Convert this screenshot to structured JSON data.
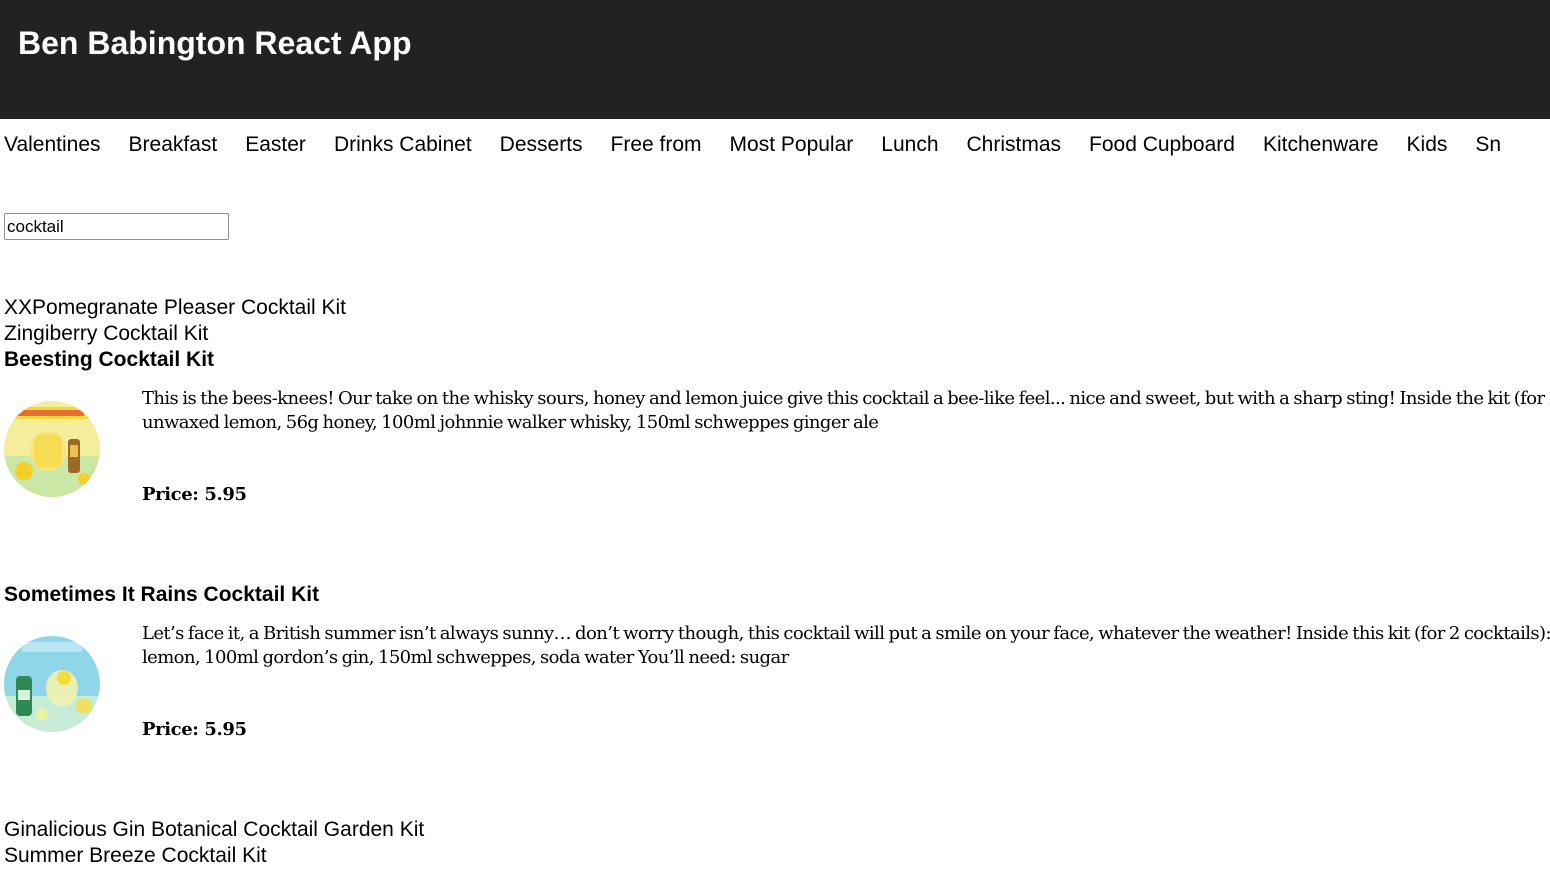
{
  "app": {
    "title": "Ben Babington React App"
  },
  "nav": {
    "items": [
      {
        "label": "Valentines"
      },
      {
        "label": "Breakfast"
      },
      {
        "label": "Easter"
      },
      {
        "label": "Drinks Cabinet"
      },
      {
        "label": "Desserts"
      },
      {
        "label": "Free from"
      },
      {
        "label": "Most Popular"
      },
      {
        "label": "Lunch"
      },
      {
        "label": "Christmas"
      },
      {
        "label": "Food Cupboard"
      },
      {
        "label": "Kitchenware"
      },
      {
        "label": "Kids"
      },
      {
        "label": "Sn"
      }
    ]
  },
  "search": {
    "value": "cocktail"
  },
  "results": {
    "titles_before": [
      "XXPomegranate Pleaser Cocktail Kit",
      "Zingiberry Cocktail Kit"
    ],
    "products": [
      {
        "title": "Beesting Cocktail Kit",
        "description": "This is the bees-knees! Our take on the whisky sours, honey and lemon juice give this cocktail a bee-like feel... nice and sweet, but with a sharp sting! Inside the kit (for 2 unwaxed lemon, 56g honey, 100ml johnnie walker whisky, 150ml schweppes ginger ale",
        "price": "Price: 5.95",
        "image_colors": [
          "#f2d83a",
          "#c8e6a0",
          "#f7f0b0"
        ]
      },
      {
        "title": "Sometimes It Rains Cocktail Kit",
        "description": "Let’s face it, a British summer isn’t always sunny… don’t worry though, this cocktail will put a smile on your face, whatever the weather! Inside this kit (for 2 cocktails): lemon, 100ml gordon’s gin, 150ml schweppes, soda water You’ll need: sugar",
        "price": "Price: 5.95",
        "image_colors": [
          "#7fd3e6",
          "#e8f0a0",
          "#2e8a55"
        ]
      }
    ],
    "titles_after": [
      "Ginalicious Gin Botanical Cocktail Garden Kit",
      "Summer Breeze Cocktail Kit"
    ]
  },
  "colors": {
    "header_bg": "#222222",
    "header_text": "#ffffff",
    "text": "#000000"
  }
}
